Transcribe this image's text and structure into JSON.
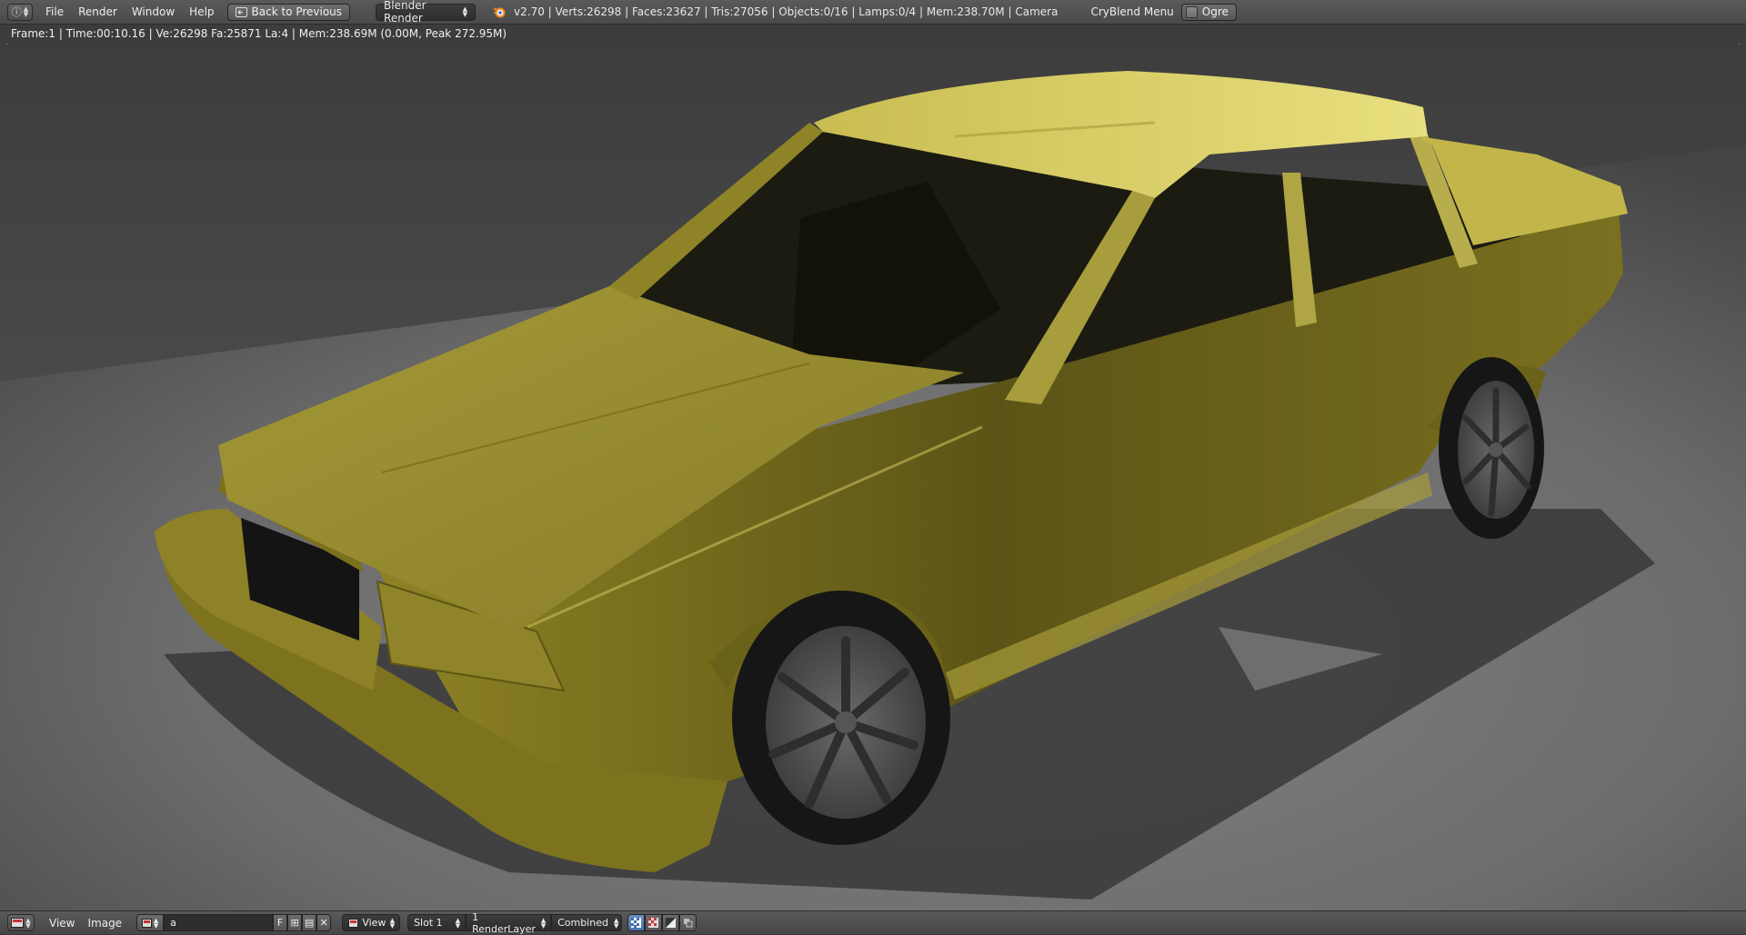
{
  "header": {
    "editor_icon": "info-icon",
    "menus": [
      "File",
      "Render",
      "Window",
      "Help"
    ],
    "back_button_label": "Back to Previous",
    "render_engine": "Blender Render",
    "stats": "v2.70 | Verts:26298 | Faces:23627 | Tris:27056 | Objects:0/16 | Lamps:0/4 | Mem:238.70M | Camera",
    "cryblend_menu": "CryBlend Menu",
    "ogre_label": "Ogre",
    "ogre_checked": false
  },
  "render_info": "Frame:1 | Time:00:10.16 | Ve:26298 Fa:25871 La:4 | Mem:238.69M (0.00M, Peak 272.95M)",
  "viewport": {
    "content": "rendered-car-image",
    "car_color": "#b5a93c",
    "background_color": "#4a4a4a"
  },
  "footer": {
    "editor_icon": "image-editor-icon",
    "menus": [
      "View",
      "Image"
    ],
    "image_name": "a",
    "fake_user_label": "F",
    "view_dropdown": "View",
    "slot_dropdown": "Slot 1",
    "layer_dropdown": "1 RenderLayer",
    "pass_dropdown": "Combined",
    "display_buttons": [
      "draw-alpha-icon",
      "checker-icon",
      "z-buffer-icon",
      "channel-icon"
    ]
  }
}
